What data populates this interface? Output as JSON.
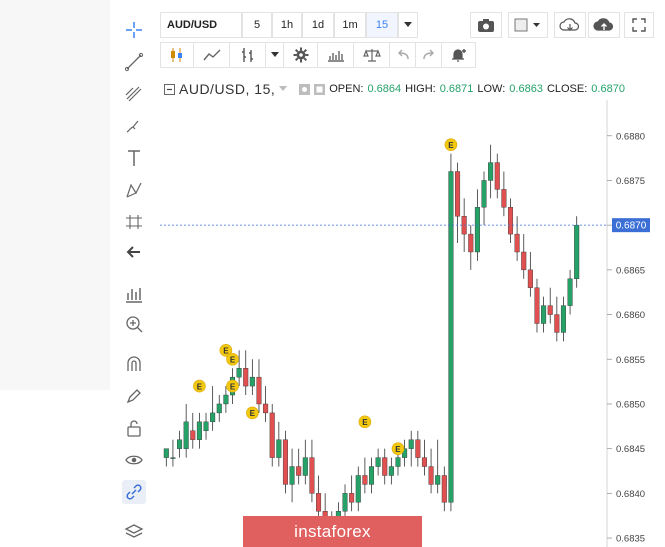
{
  "symbol_field": "AUD/USD",
  "intervals": [
    "5",
    "1h",
    "1d",
    "1m",
    "15"
  ],
  "selected_interval": "15",
  "legend": {
    "symbol": "AUD/USD, 15,",
    "open_label": "OPEN:",
    "open": "0.6864",
    "high_label": "HIGH:",
    "high": "0.6871",
    "low_label": "LOW:",
    "low": "0.6863",
    "close_label": "CLOSE:",
    "close": "0.6870"
  },
  "price_axis_ticks": [
    "0.6880",
    "0.6875",
    "0.6870",
    "0.6865",
    "0.6860",
    "0.6855",
    "0.6850",
    "0.6845",
    "0.6840",
    "0.6835"
  ],
  "last_price_label": "0.6870",
  "watermark": "instaforex",
  "event_marker_label": "E",
  "colors": {
    "up": "#26a269",
    "down": "#e05050",
    "accent": "#3b82f6",
    "price_line": "#3b6fd6"
  },
  "toolbar_icons": [
    "camera-icon",
    "color-picker-icon",
    "cloud-download-icon",
    "cloud-upload-icon",
    "fullscreen-icon"
  ],
  "toolbar2_icons": [
    "candles-icon",
    "line-chart-icon",
    "bar-chart-icon",
    "settings-icon",
    "indicators-icon",
    "compare-icon",
    "undo-icon",
    "redo-icon",
    "alert-icon"
  ],
  "chart_data": {
    "type": "candlestick",
    "ylim": [
      0.6834,
      0.6884
    ],
    "grid": false,
    "candles": [
      [
        0.6844,
        0.6845,
        0.6843,
        0.6845
      ],
      [
        0.6844,
        0.6846,
        0.6843,
        0.6844
      ],
      [
        0.6845,
        0.6847,
        0.6844,
        0.6846
      ],
      [
        0.6845,
        0.685,
        0.6844,
        0.6848
      ],
      [
        0.6847,
        0.6849,
        0.6845,
        0.6846
      ],
      [
        0.6846,
        0.6849,
        0.6845,
        0.6848
      ],
      [
        0.6847,
        0.6849,
        0.6846,
        0.6848
      ],
      [
        0.6848,
        0.6852,
        0.6847,
        0.6849
      ],
      [
        0.6849,
        0.6851,
        0.6848,
        0.685
      ],
      [
        0.685,
        0.6852,
        0.6849,
        0.6851
      ],
      [
        0.6851,
        0.6854,
        0.685,
        0.6853
      ],
      [
        0.6853,
        0.6856,
        0.6852,
        0.6854
      ],
      [
        0.6854,
        0.6856,
        0.6851,
        0.6852
      ],
      [
        0.6852,
        0.6855,
        0.6851,
        0.6853
      ],
      [
        0.6853,
        0.6855,
        0.6849,
        0.685
      ],
      [
        0.685,
        0.6852,
        0.6848,
        0.6849
      ],
      [
        0.6849,
        0.685,
        0.6843,
        0.6844
      ],
      [
        0.6844,
        0.6848,
        0.6843,
        0.6846
      ],
      [
        0.6846,
        0.6847,
        0.684,
        0.6841
      ],
      [
        0.6841,
        0.6845,
        0.6839,
        0.6843
      ],
      [
        0.6843,
        0.6845,
        0.6841,
        0.6842
      ],
      [
        0.6842,
        0.6846,
        0.6841,
        0.6844
      ],
      [
        0.6844,
        0.6846,
        0.6839,
        0.684
      ],
      [
        0.684,
        0.6842,
        0.6837,
        0.6838
      ],
      [
        0.6838,
        0.684,
        0.6835,
        0.6836
      ],
      [
        0.6836,
        0.6838,
        0.6834,
        0.6837
      ],
      [
        0.6837,
        0.6839,
        0.6836,
        0.6838
      ],
      [
        0.6838,
        0.6841,
        0.6837,
        0.684
      ],
      [
        0.684,
        0.6842,
        0.6838,
        0.6839
      ],
      [
        0.6839,
        0.6843,
        0.6838,
        0.6842
      ],
      [
        0.6842,
        0.6844,
        0.684,
        0.6841
      ],
      [
        0.6841,
        0.6844,
        0.684,
        0.6843
      ],
      [
        0.6843,
        0.6845,
        0.6842,
        0.6844
      ],
      [
        0.6844,
        0.6845,
        0.6841,
        0.6842
      ],
      [
        0.6842,
        0.6844,
        0.6841,
        0.6843
      ],
      [
        0.6843,
        0.6845,
        0.6842,
        0.6844
      ],
      [
        0.6844,
        0.6846,
        0.6843,
        0.6845
      ],
      [
        0.6845,
        0.6847,
        0.6843,
        0.6846
      ],
      [
        0.6846,
        0.6847,
        0.6843,
        0.6844
      ],
      [
        0.6844,
        0.6846,
        0.6842,
        0.6843
      ],
      [
        0.6843,
        0.6845,
        0.684,
        0.6841
      ],
      [
        0.6841,
        0.6846,
        0.684,
        0.6842
      ],
      [
        0.6842,
        0.6843,
        0.6838,
        0.6839
      ],
      [
        0.6839,
        0.6878,
        0.6838,
        0.6876
      ],
      [
        0.6876,
        0.6877,
        0.6868,
        0.6871
      ],
      [
        0.6871,
        0.6873,
        0.6867,
        0.6869
      ],
      [
        0.6869,
        0.687,
        0.6865,
        0.6867
      ],
      [
        0.6867,
        0.6874,
        0.6866,
        0.6872
      ],
      [
        0.6872,
        0.6876,
        0.687,
        0.6875
      ],
      [
        0.6875,
        0.6879,
        0.6873,
        0.6877
      ],
      [
        0.6877,
        0.6878,
        0.6873,
        0.6874
      ],
      [
        0.6874,
        0.6876,
        0.6871,
        0.6872
      ],
      [
        0.6872,
        0.6873,
        0.6868,
        0.6869
      ],
      [
        0.6869,
        0.6871,
        0.6866,
        0.6867
      ],
      [
        0.6867,
        0.6869,
        0.6864,
        0.6865
      ],
      [
        0.6865,
        0.6867,
        0.6862,
        0.6863
      ],
      [
        0.6863,
        0.6864,
        0.6858,
        0.6859
      ],
      [
        0.6859,
        0.6862,
        0.6858,
        0.6861
      ],
      [
        0.6861,
        0.6863,
        0.6859,
        0.686
      ],
      [
        0.686,
        0.6862,
        0.6857,
        0.6858
      ],
      [
        0.6858,
        0.6862,
        0.6857,
        0.6861
      ],
      [
        0.6861,
        0.6865,
        0.686,
        0.6864
      ],
      [
        0.6864,
        0.6871,
        0.6863,
        0.687
      ]
    ],
    "event_markers": [
      {
        "index": 5,
        "price": 0.6852
      },
      {
        "index": 9,
        "price": 0.6856
      },
      {
        "index": 10,
        "price": 0.6855
      },
      {
        "index": 10,
        "price": 0.6852
      },
      {
        "index": 13,
        "price": 0.6849
      },
      {
        "index": 30,
        "price": 0.6848
      },
      {
        "index": 35,
        "price": 0.6845
      },
      {
        "index": 43,
        "price": 0.6879
      }
    ],
    "price_line": 0.687
  }
}
